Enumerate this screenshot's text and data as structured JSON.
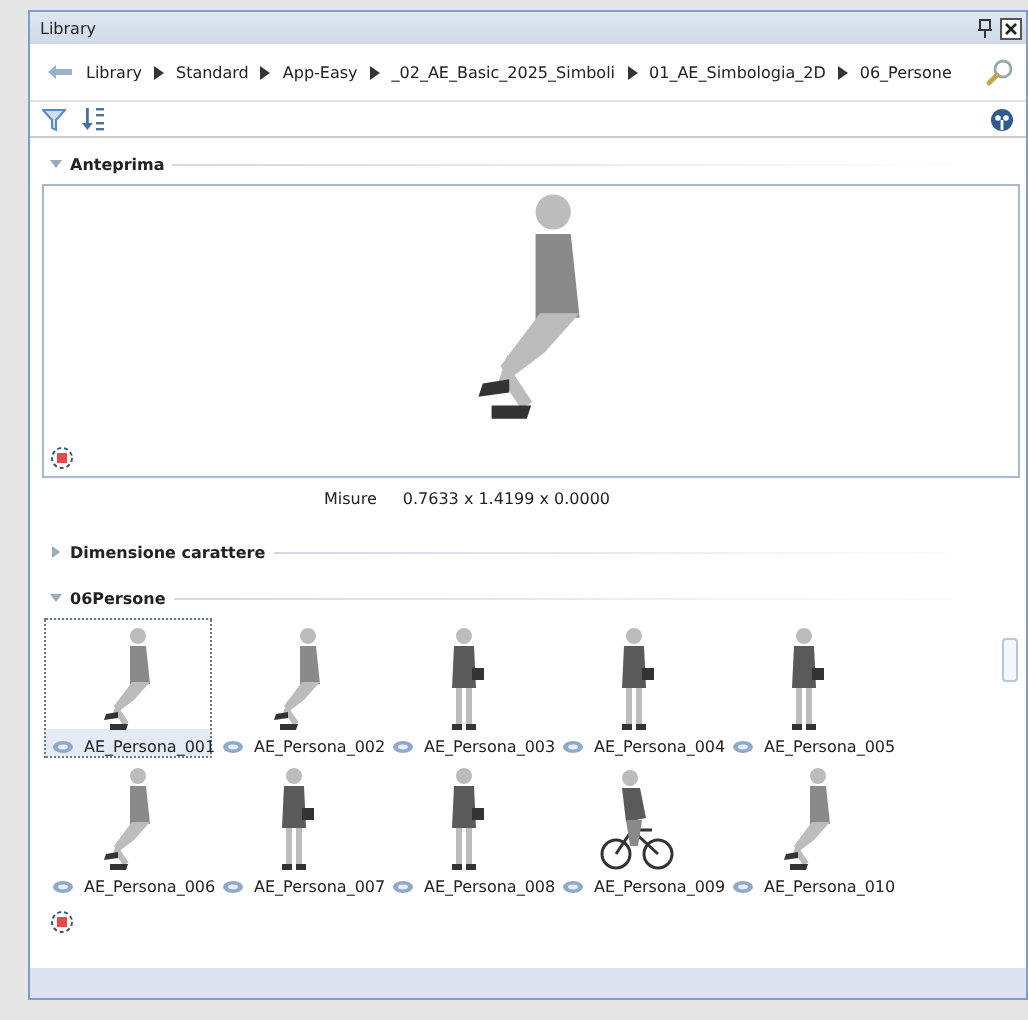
{
  "window": {
    "title": "Library"
  },
  "breadcrumb": [
    "Library",
    "Standard",
    "App-Easy",
    "_02_AE_Basic_2025_Simboli",
    "01_AE_Simbologia_2D",
    "06_Persone"
  ],
  "preview_section": {
    "title": "Anteprima",
    "expanded": true,
    "measure_label": "Misure",
    "measure_value": "0.7633 x 1.4199 x 0.0000"
  },
  "font_section": {
    "title": "Dimensione carattere",
    "expanded": false
  },
  "items_section": {
    "title": "06Persone",
    "expanded": true,
    "items": [
      {
        "label": "AE_Persona_001",
        "kind": "sitting",
        "selected": true
      },
      {
        "label": "AE_Persona_002",
        "kind": "sitting",
        "selected": false
      },
      {
        "label": "AE_Persona_003",
        "kind": "standing",
        "selected": false
      },
      {
        "label": "AE_Persona_004",
        "kind": "standing",
        "selected": false
      },
      {
        "label": "AE_Persona_005",
        "kind": "standing",
        "selected": false
      },
      {
        "label": "AE_Persona_006",
        "kind": "sitting",
        "selected": false
      },
      {
        "label": "AE_Persona_007",
        "kind": "standing",
        "selected": false
      },
      {
        "label": "AE_Persona_008",
        "kind": "standing",
        "selected": false
      },
      {
        "label": "AE_Persona_009",
        "kind": "cycling",
        "selected": false
      },
      {
        "label": "AE_Persona_010",
        "kind": "sitting",
        "selected": false
      }
    ]
  }
}
